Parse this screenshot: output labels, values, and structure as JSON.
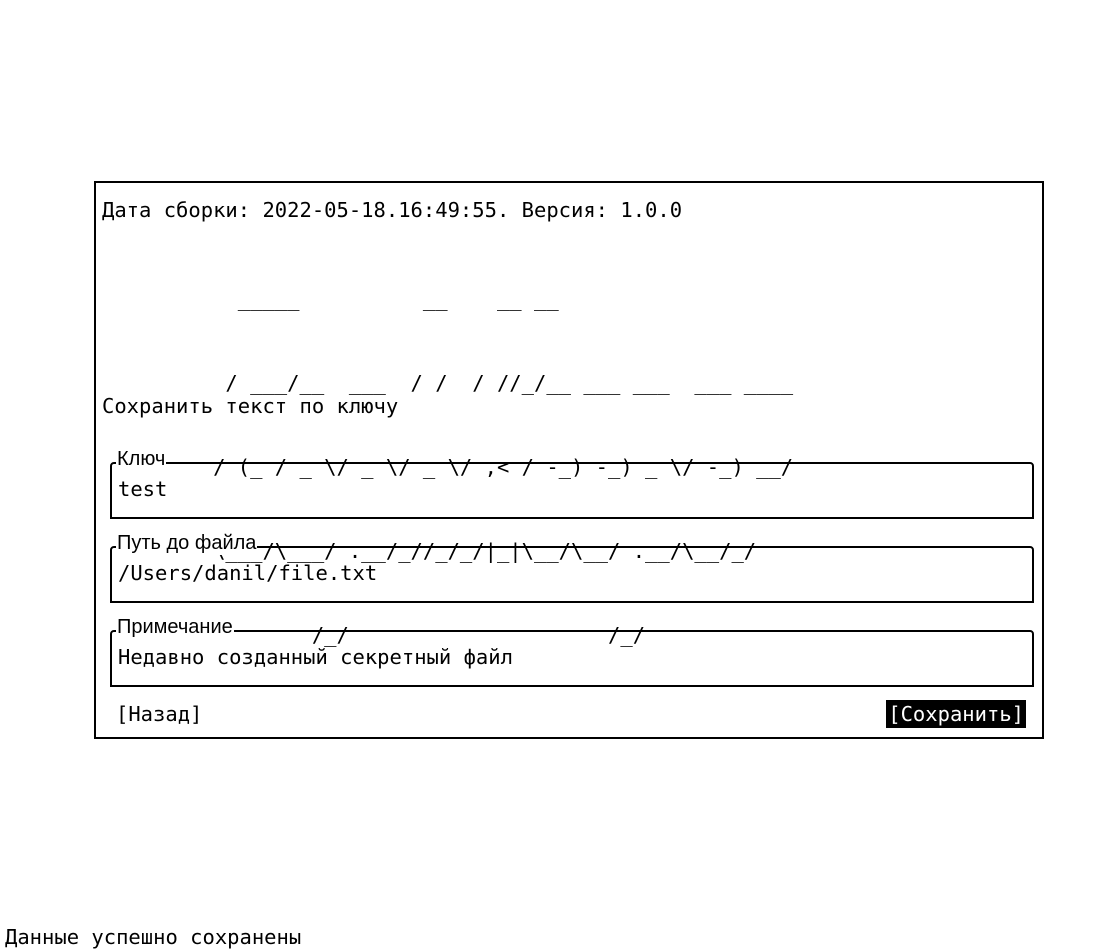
{
  "build_info": "Дата сборки: 2022-05-18.16:49:55. Версия: 1.0.0",
  "logo_lines": [
    "           _____          __    __ __",
    "          / ___/__  ___  / /  / //_/__ ___ ___  ___ ____",
    "         / (_ / _ \\/ _ \\/ _ \\/ ,< / -_) -_) _ \\/ -_) __/",
    "         \\___/\\___/ .__/_//_/_/|_|\\__/\\__/ .__/\\__/_/",
    "                 /_/                     /_/"
  ],
  "subtitle": "Сохранить текст по ключу",
  "fields": {
    "key": {
      "label": "Ключ",
      "value": "test"
    },
    "path": {
      "label": "Путь до файла",
      "value": "/Users/danil/file.txt"
    },
    "note": {
      "label": "Примечание",
      "value": "Недавно созданный секретный файл"
    }
  },
  "buttons": {
    "back": "[Назад]",
    "save": "[Сохранить]"
  },
  "status": "Данные успешно сохранены"
}
